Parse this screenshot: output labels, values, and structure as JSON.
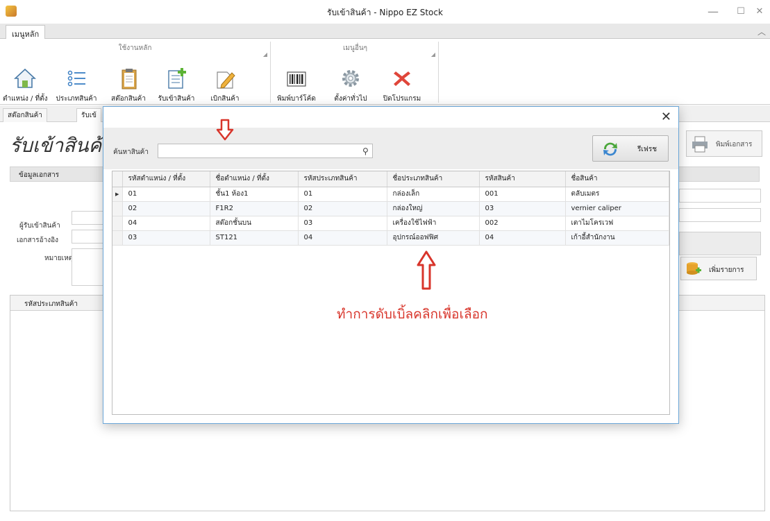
{
  "window": {
    "title": "รับเข้าสินค้า - Nippo EZ Stock",
    "minimize": "—",
    "maximize": "☐",
    "close": "✕"
  },
  "ribbon": {
    "tab_label": "เมนูหลัก",
    "collapse_icon": "chevron-up-icon",
    "groups": [
      {
        "title": "ใช้งานหลัก",
        "buttons": [
          {
            "label": "ตำแหน่ง / ที่ตั้ง",
            "icon": "home-icon"
          },
          {
            "label": "ประเภทสินค้า",
            "icon": "list-icon"
          },
          {
            "label": "สต๊อกสินค้า",
            "icon": "clipboard-icon"
          },
          {
            "label": "รับเข้าสินค้า",
            "icon": "document-add-icon"
          },
          {
            "label": "เบิกสินค้า",
            "icon": "pencil-icon"
          }
        ]
      },
      {
        "title": "เมนูอื่นๆ",
        "buttons": [
          {
            "label": "พิมพ์บาร์โค้ด",
            "icon": "barcode-icon"
          },
          {
            "label": "ตั้งค่าทั่วไป",
            "icon": "gear-icon"
          },
          {
            "label": "ปิดโปรแกรม",
            "icon": "close-x-icon"
          }
        ]
      }
    ]
  },
  "doc_tabs": [
    "สต๊อกสินค้า",
    "รับเข้"
  ],
  "page": {
    "title": "รับเข้าสินค้",
    "section_header": "ข้อมูลเอกสาร",
    "labels": {
      "receiver": "ผู้รับเข้าสินค้า",
      "reference": "เอกสารอ้างอิง",
      "note": "หมายเหตุ"
    },
    "grid_header": "รหัสประเภทสินค้า",
    "print_button": "พิมพ์เอกสาร",
    "add_item_button": "เพิ่มรายการ"
  },
  "dialog": {
    "close": "✕",
    "search_label": "ค้นหาสินค้า",
    "search_value": "",
    "refresh_label": "รีเฟรช",
    "columns": [
      "รหัสตำแหน่ง / ที่ตั้ง",
      "ชื่อตำแหน่ง / ที่ตั้ง",
      "รหัสประเภทสินค้า",
      "ชื่อประเภทสินค้า",
      "รหัสสินค้า",
      "ชื่อสินค้า"
    ],
    "rows": [
      [
        "01",
        "ชั้น1 ห้อง1",
        "01",
        "กล่องเล็ก",
        "001",
        "ตลับเมตร"
      ],
      [
        "02",
        "F1R2",
        "02",
        "กล่องใหญ่",
        "03",
        "vernier caliper"
      ],
      [
        "04",
        "สต๊อกชั้นบน",
        "03",
        "เครื่องใช้ไฟฟ้า",
        "002",
        "เตาไมโครเวฟ"
      ],
      [
        "03",
        "ST121",
        "04",
        "อุปกรณ์ออฟฟิศ",
        "04",
        "เก้าอี้สำนักงาน"
      ]
    ]
  },
  "annotation": "ทำการดับเบิ้ลคลิกเพื่อเลือก",
  "colors": {
    "annotation": "#d8352b",
    "dialog_border": "#6aa6d8"
  }
}
